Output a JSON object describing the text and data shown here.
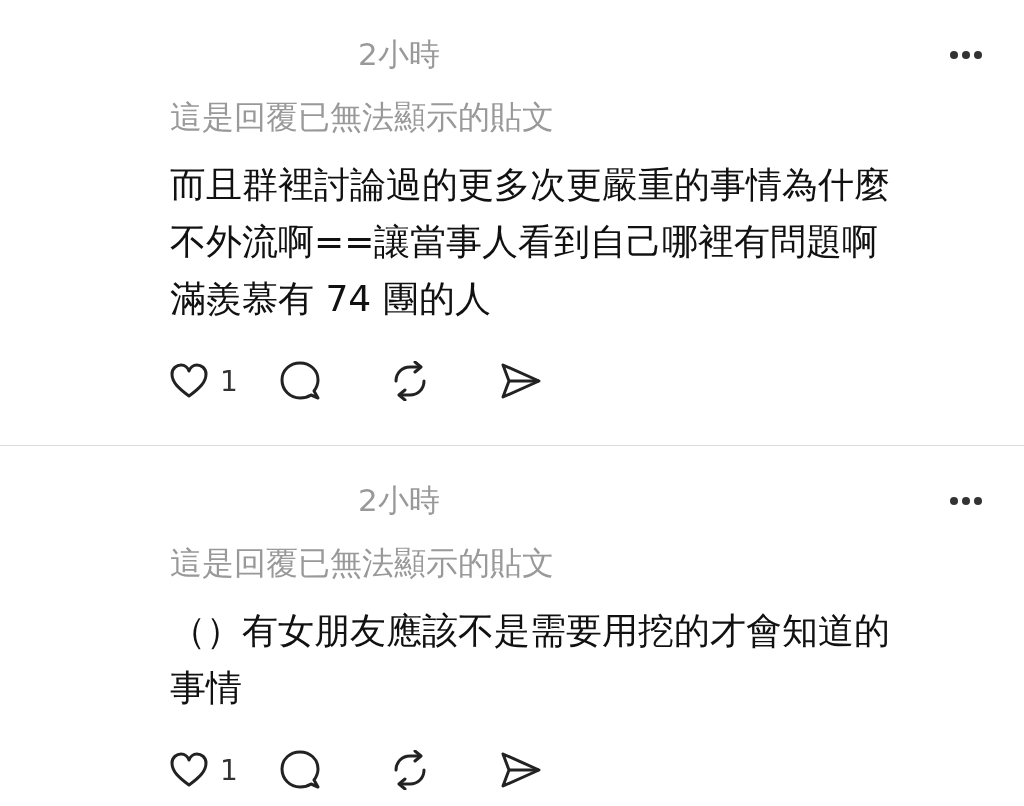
{
  "posts": [
    {
      "time": "2小時",
      "context": "這是回覆已無法顯示的貼文",
      "body_lines": [
        "而且群裡討論過的更多次更嚴重的事情為什麼",
        "不外流啊==讓當事人看到自己哪裡有問題啊",
        "滿羨慕有 74 團的人"
      ],
      "like_count": "1"
    },
    {
      "time": "2小時",
      "context": "這是回覆已無法顯示的貼文",
      "body_lines": [
        "（）有女朋友應該不是需要用挖的才會知道的",
        "事情"
      ],
      "like_count": "1"
    }
  ]
}
